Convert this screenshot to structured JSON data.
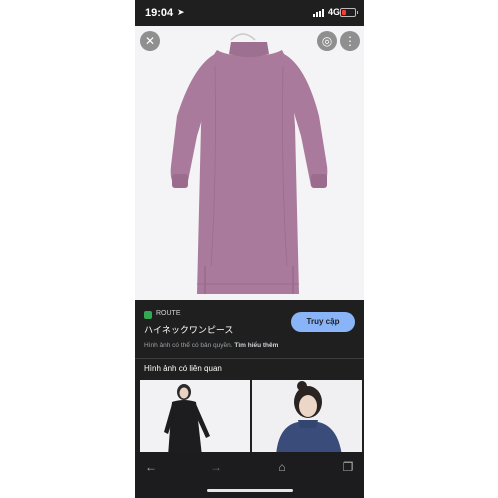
{
  "status_bar": {
    "time": "19:04",
    "location_icon": "location-arrow-icon",
    "network": "4G",
    "battery_color": "#ff3b30",
    "battery_level": 0.3
  },
  "image_viewer": {
    "close_icon": "close-icon",
    "lens_icon": "lens-icon",
    "more_icon": "more-vert-icon",
    "dress_color": "#a97a9b"
  },
  "result": {
    "source": "ROUTE",
    "title": "ハイネックワンピース",
    "visit_label": "Truy cập",
    "copyright_text": "Hình ảnh có thể có bản quyền.",
    "learn_more": "Tìm hiểu thêm"
  },
  "related": {
    "heading": "Hình ảnh có liên quan"
  },
  "browser_nav": {
    "back_icon": "back-arrow-icon",
    "forward_icon": "forward-arrow-icon",
    "home_icon": "home-icon",
    "tabs_icon": "tabs-icon"
  }
}
